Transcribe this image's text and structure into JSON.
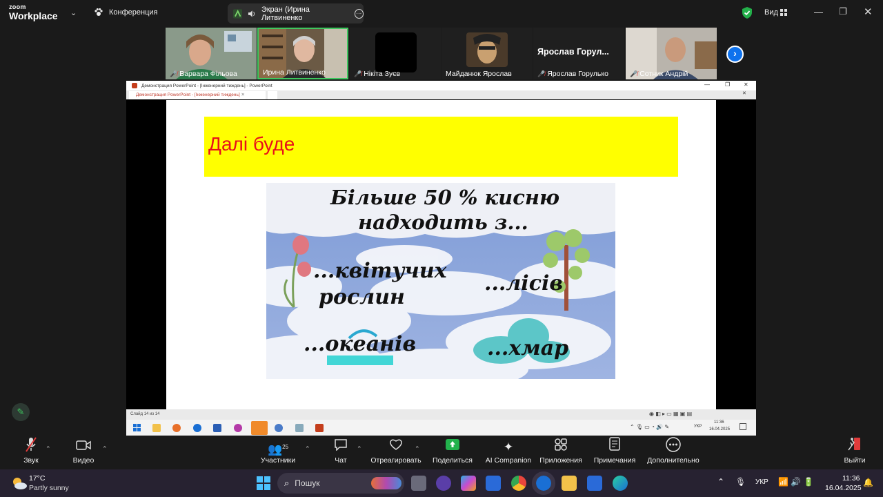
{
  "top": {
    "logo_small": "zoom",
    "logo_big": "Workplace",
    "meeting_label": "Конференция",
    "share_label": "Экран (Ирина Литвиненко",
    "view_label": "Вид"
  },
  "participants": [
    {
      "name": "Варвара Фільова",
      "muted": true
    },
    {
      "name": "Ирина Литвиненко",
      "muted": false
    },
    {
      "name": "Нікіта Зуєв",
      "muted": true
    },
    {
      "name": "Майданюк Ярослав",
      "muted": false
    },
    {
      "name": "Ярослав Горулько",
      "muted": true,
      "big_name": "Ярослав  Горул..."
    },
    {
      "name": "Сотник Андрій",
      "muted": true
    }
  ],
  "powerpoint": {
    "window_title": "Демонстрация PowerPoint - [Інженерний тиждень] - PowerPoint",
    "tab_title": "Демонстрация PowerPoint - [Інженерний тиждень]",
    "slide_counter": "Слайд 14 из 14",
    "inner_clock_time": "11:36",
    "inner_clock_date": "16.04.2025",
    "inner_lang": "УКР"
  },
  "slide": {
    "heading": "Далі буде",
    "picture_title_line1": "Більше 50 % кисню",
    "picture_title_line2": "надходить з...",
    "item1_line1": "...квітучих",
    "item1_line2": "рослин",
    "item2": "...лісів",
    "item3": "...океанів",
    "item4": "...хмар"
  },
  "toolbar": {
    "audio": "Звук",
    "video": "Видео",
    "participants": "Участники",
    "participants_count": "25",
    "chat": "Чат",
    "react": "Отреагировать",
    "share": "Поделиться",
    "ai": "AI Companion",
    "apps": "Приложения",
    "notes": "Примечания",
    "more": "Дополнительно",
    "leave": "Выйти"
  },
  "taskbar": {
    "weather_temp": "17°C",
    "weather_desc": "Partly sunny",
    "search_placeholder": "Пошук",
    "lang": "УКР",
    "time": "11:36",
    "date": "16.04.2025"
  },
  "colors": {
    "banner_yellow": "#ffff00",
    "heading_red": "#e8101a",
    "active_green": "#3fc75f",
    "share_green": "#22b24c",
    "taskbar_bg": "#272231"
  }
}
